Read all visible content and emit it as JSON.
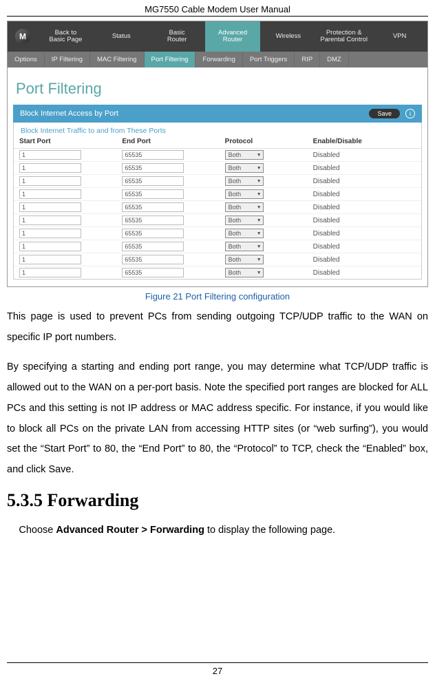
{
  "header": "MG7550 Cable Modem User Manual",
  "footer": "27",
  "shot": {
    "logo_letter": "M",
    "topnav": [
      {
        "line1": "Back to",
        "line2": "Basic Page",
        "active": false
      },
      {
        "line1": "Status",
        "line2": "",
        "active": false
      },
      {
        "line1": "Basic",
        "line2": "Router",
        "active": false
      },
      {
        "line1": "Advanced",
        "line2": "Router",
        "active": true
      },
      {
        "line1": "Wireless",
        "line2": "",
        "active": false
      },
      {
        "line1": "Protection &",
        "line2": "Parental Control",
        "active": false
      },
      {
        "line1": "VPN",
        "line2": "",
        "active": false
      }
    ],
    "subnav": [
      {
        "label": "Options",
        "active": false
      },
      {
        "label": "IP Filtering",
        "active": false
      },
      {
        "label": "MAC Filtering",
        "active": false
      },
      {
        "label": "Port Filtering",
        "active": true
      },
      {
        "label": "Forwarding",
        "active": false
      },
      {
        "label": "Port Triggers",
        "active": false
      },
      {
        "label": "RIP",
        "active": false
      },
      {
        "label": "DMZ",
        "active": false
      }
    ],
    "section_title": "Port Filtering",
    "block_bar": "Block Internet Access by Port",
    "save_label": "Save",
    "help_label": "i",
    "traffic_bar": "Block Internet Traffic to and from These Ports",
    "table": {
      "headers": [
        "Start Port",
        "End Port",
        "Protocol",
        "Enable/Disable"
      ],
      "rows": [
        {
          "start": "1",
          "end": "65535",
          "proto": "Both",
          "state": "Disabled"
        },
        {
          "start": "1",
          "end": "65535",
          "proto": "Both",
          "state": "Disabled"
        },
        {
          "start": "1",
          "end": "65535",
          "proto": "Both",
          "state": "Disabled"
        },
        {
          "start": "1",
          "end": "65535",
          "proto": "Both",
          "state": "Disabled"
        },
        {
          "start": "1",
          "end": "65535",
          "proto": "Both",
          "state": "Disabled"
        },
        {
          "start": "1",
          "end": "65535",
          "proto": "Both",
          "state": "Disabled"
        },
        {
          "start": "1",
          "end": "65535",
          "proto": "Both",
          "state": "Disabled"
        },
        {
          "start": "1",
          "end": "65535",
          "proto": "Both",
          "state": "Disabled"
        },
        {
          "start": "1",
          "end": "65535",
          "proto": "Both",
          "state": "Disabled"
        },
        {
          "start": "1",
          "end": "65535",
          "proto": "Both",
          "state": "Disabled"
        }
      ]
    }
  },
  "caption": "Figure 21 Port Filtering configuration",
  "para1": "This page is used to prevent PCs from sending outgoing TCP/UDP traffic to the WAN on specific IP port numbers.",
  "para2": "By specifying a starting and ending port range, you may determine what TCP/UDP traffic is allowed out to the WAN on a per-port basis.   Note the specified port ranges are blocked for ALL PCs and this setting is not IP address or MAC address specific. For instance, if you would like to block all PCs on the private LAN from accessing HTTP sites (or “web surfing”), you would set the “Start Port” to 80, the “End Port” to 80, the “Protocol” to TCP, check the “Enabled” box, and click Save.",
  "heading": "5.3.5  Forwarding",
  "para3_pre": "Choose ",
  "para3_bold": "Advanced Router > Forwarding",
  "para3_post": " to display the following page."
}
